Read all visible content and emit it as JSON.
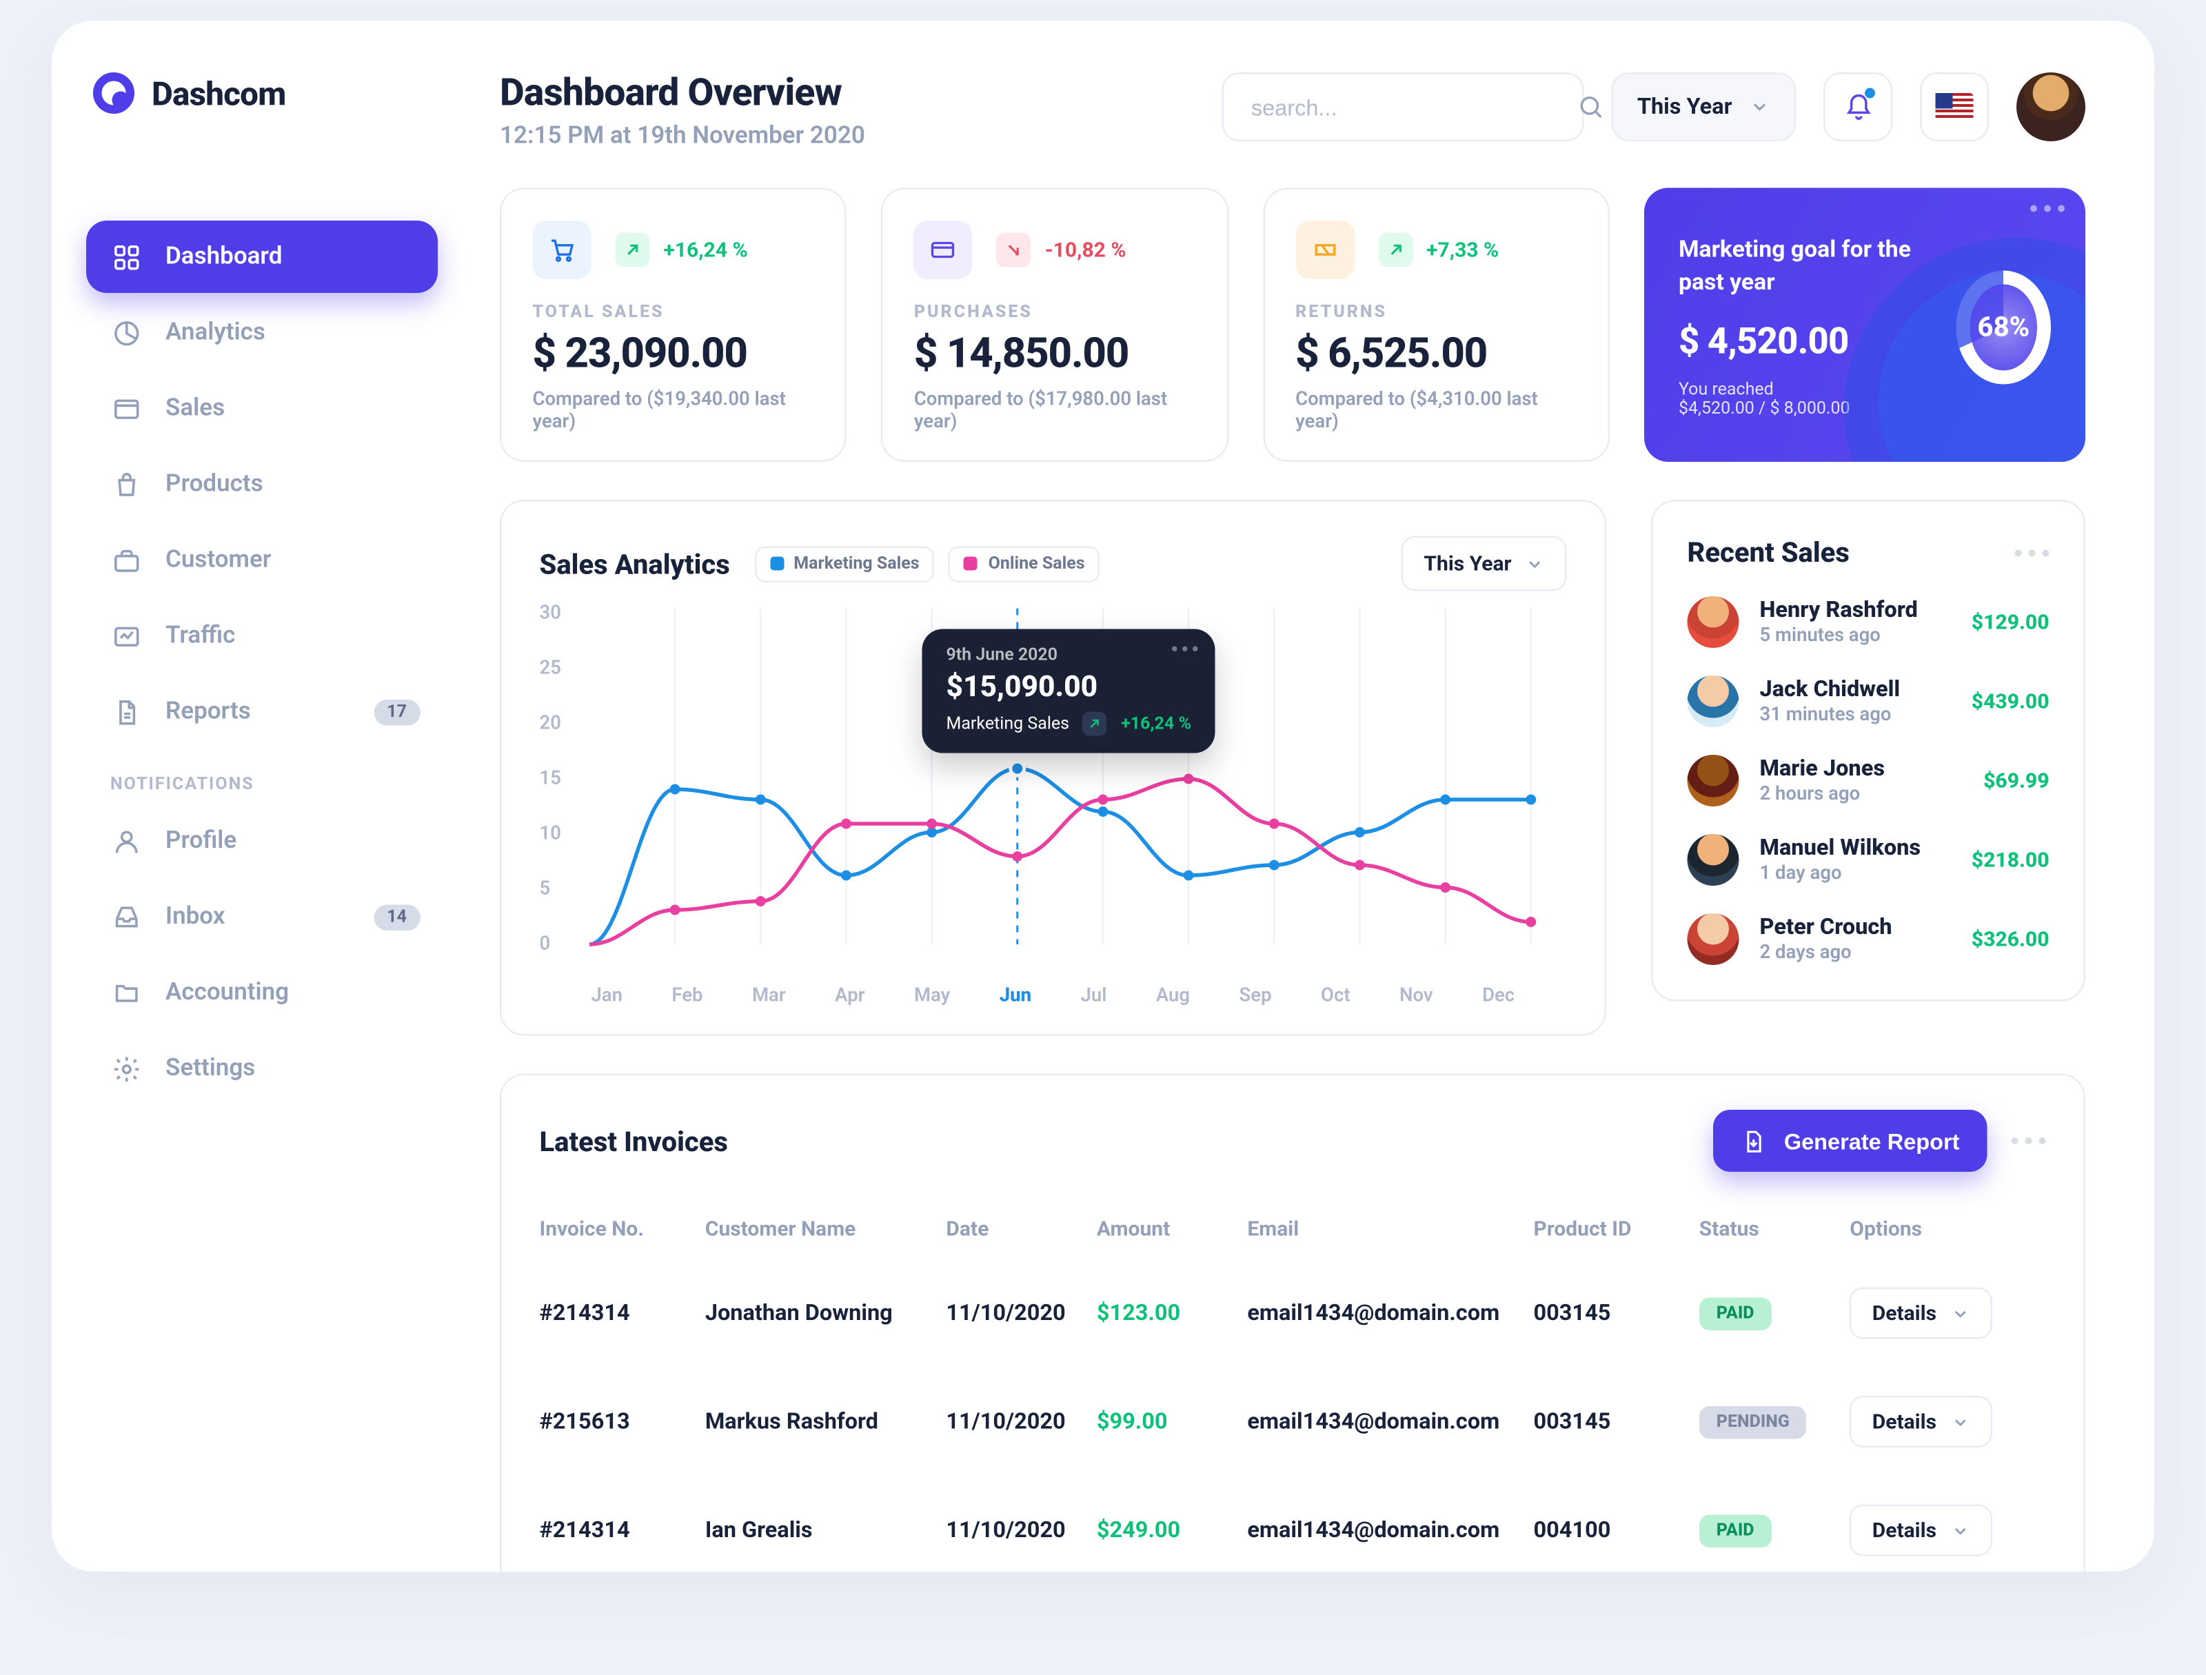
{
  "brand": {
    "name": "Dashcom"
  },
  "sidebar": {
    "primary": [
      {
        "label": "Dashboard",
        "icon": "grid"
      },
      {
        "label": "Analytics",
        "icon": "pie"
      },
      {
        "label": "Sales",
        "icon": "window"
      },
      {
        "label": "Products",
        "icon": "bag"
      },
      {
        "label": "Customer",
        "icon": "briefcase"
      },
      {
        "label": "Traffic",
        "icon": "activity"
      },
      {
        "label": "Reports",
        "icon": "file",
        "badge": "17"
      }
    ],
    "section_label": "NOTIFICATIONS",
    "secondary": [
      {
        "label": "Profile",
        "icon": "user"
      },
      {
        "label": "Inbox",
        "icon": "inbox",
        "badge": "14"
      },
      {
        "label": "Accounting",
        "icon": "folder"
      },
      {
        "label": "Settings",
        "icon": "gear"
      }
    ]
  },
  "header": {
    "title": "Dashboard Overview",
    "subtitle": "12:15 PM at 19th November 2020",
    "search_placeholder": "search...",
    "range_label": "This Year"
  },
  "kpi": [
    {
      "delta": "+16,24 %",
      "dir": "up",
      "label": "TOTAL SALES",
      "value": "$ 23,090.00",
      "sub": "Compared to ($19,340.00 last year)"
    },
    {
      "delta": "-10,82 %",
      "dir": "down",
      "label": "PURCHASES",
      "value": "$ 14,850.00",
      "sub": "Compared to ($17,980.00 last year)"
    },
    {
      "delta": "+7,33 %",
      "dir": "up",
      "label": "RETURNS",
      "value": "$ 6,525.00",
      "sub": "Compared to ($4,310.00 last year)"
    }
  ],
  "goal": {
    "title": "Marketing goal for the past year",
    "value": "$ 4,520.00",
    "reached_label": "You reached",
    "reached_value": "$4,520.00 / $ 8,000.00",
    "percent": "68%"
  },
  "analytics": {
    "title": "Sales Analytics",
    "legend": [
      {
        "label": "Marketing Sales",
        "color": "#1C8FE5"
      },
      {
        "label": "Online Sales",
        "color": "#E83FA0"
      }
    ],
    "range": "This Year",
    "y_ticks": [
      "30",
      "25",
      "20",
      "15",
      "10",
      "5",
      "0"
    ],
    "x_labels": [
      "Jan",
      "Feb",
      "Mar",
      "Apr",
      "May",
      "Jun",
      "Jul",
      "Aug",
      "Sep",
      "Oct",
      "Nov",
      "Dec"
    ],
    "highlight_idx": 5,
    "tooltip": {
      "date": "9th June 2020",
      "value": "$15,090.00",
      "series": "Marketing Sales",
      "delta": "+16,24 %"
    }
  },
  "chart_data": {
    "type": "line",
    "title": "Sales Analytics",
    "xlabel": "",
    "ylabel": "",
    "ylim": [
      0,
      30
    ],
    "categories": [
      "Jan",
      "Feb",
      "Mar",
      "Apr",
      "May",
      "Jun",
      "Jul",
      "Aug",
      "Sep",
      "Oct",
      "Nov",
      "Dec"
    ],
    "series": [
      {
        "name": "Marketing Sales",
        "color": "#1C8FE5",
        "values": [
          0,
          14,
          13,
          6,
          10,
          16,
          12,
          6,
          7,
          10,
          13,
          13
        ]
      },
      {
        "name": "Online Sales",
        "color": "#E83FA0",
        "values": [
          0,
          3,
          4,
          11,
          11,
          8,
          13,
          15,
          11,
          7,
          5,
          2
        ]
      }
    ]
  },
  "recent_sales": {
    "title": "Recent Sales",
    "items": [
      {
        "name": "Henry Rashford",
        "ago": "5 minutes ago",
        "amount": "$129.00"
      },
      {
        "name": "Jack Chidwell",
        "ago": "31 minutes ago",
        "amount": "$439.00"
      },
      {
        "name": "Marie Jones",
        "ago": "2 hours ago",
        "amount": "$69.99"
      },
      {
        "name": "Manuel Wilkons",
        "ago": "1 day ago",
        "amount": "$218.00"
      },
      {
        "name": "Peter Crouch",
        "ago": "2 days ago",
        "amount": "$326.00"
      }
    ]
  },
  "invoices": {
    "title": "Latest Invoices",
    "button": "Generate Report",
    "details_label": "Details",
    "columns": [
      "Invoice No.",
      "Customer Name",
      "Date",
      "Amount",
      "Email",
      "Product ID",
      "Status",
      "Options"
    ],
    "rows": [
      {
        "no": "#214314",
        "customer": "Jonathan Downing",
        "date": "11/10/2020",
        "amount": "$123.00",
        "email": "email1434@domain.com",
        "product": "003145",
        "status": "PAID"
      },
      {
        "no": "#215613",
        "customer": "Markus Rashford",
        "date": "11/10/2020",
        "amount": "$99.00",
        "email": "email1434@domain.com",
        "product": "003145",
        "status": "PENDING"
      },
      {
        "no": "#214314",
        "customer": "Ian Grealis",
        "date": "11/10/2020",
        "amount": "$249.00",
        "email": "email1434@domain.com",
        "product": "004100",
        "status": "PAID"
      }
    ]
  }
}
